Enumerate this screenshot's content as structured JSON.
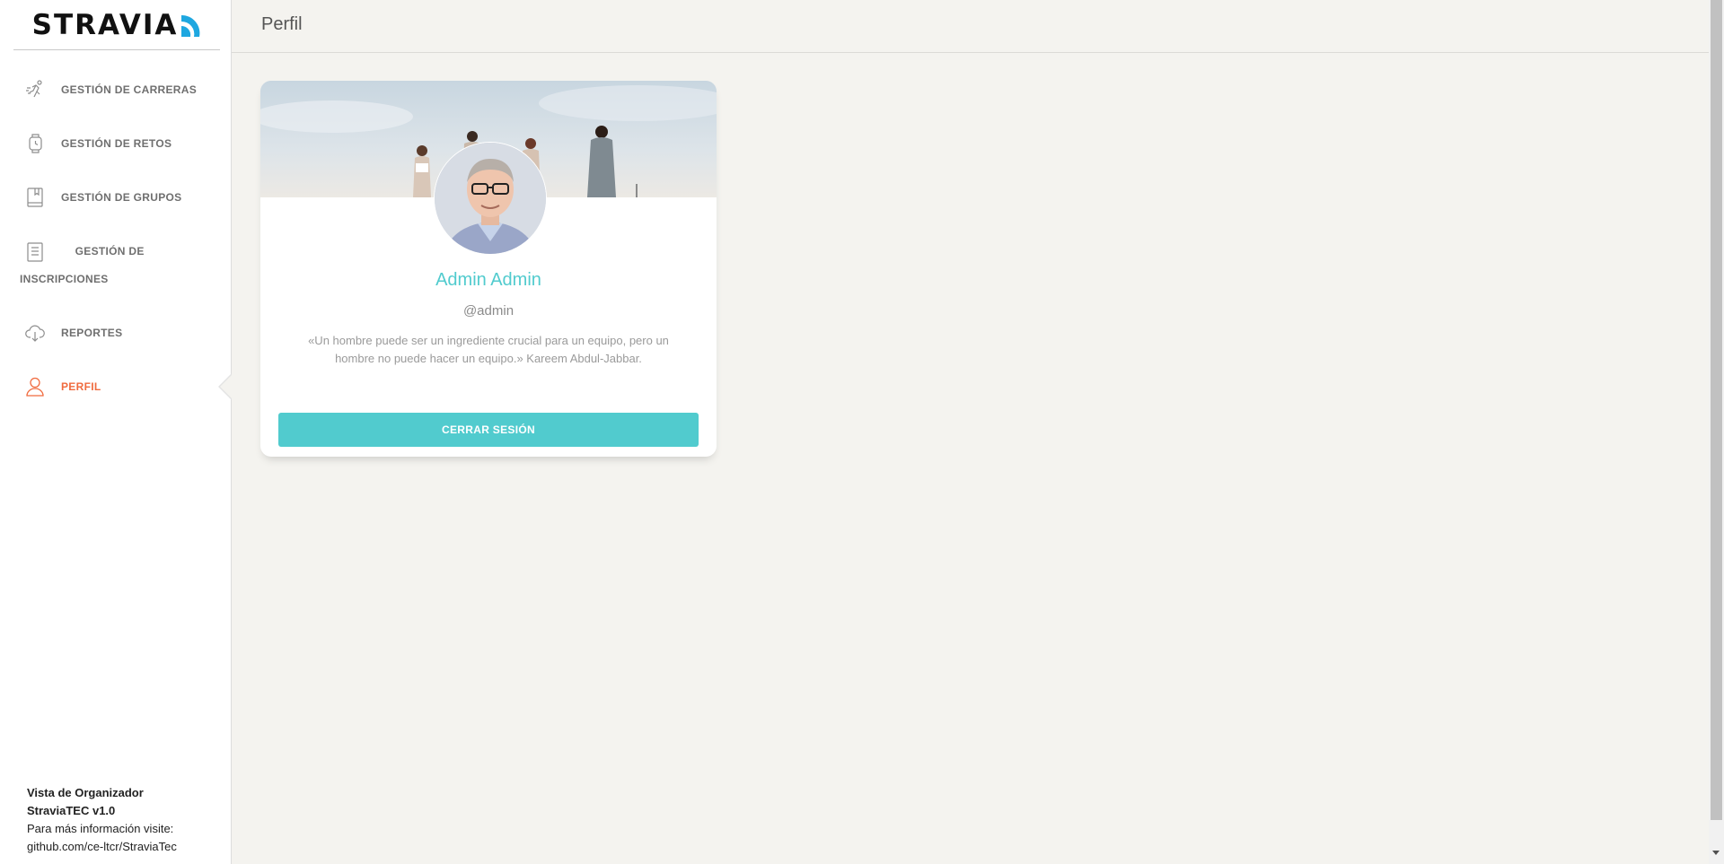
{
  "brand": {
    "name": "STRAVIA"
  },
  "sidebar": {
    "items": [
      {
        "label": "GESTIÓN DE CARRERAS",
        "icon": "runner-icon",
        "active": false
      },
      {
        "label": "GESTIÓN DE RETOS",
        "icon": "watch-icon",
        "active": false
      },
      {
        "label": "GESTIÓN DE GRUPOS",
        "icon": "bookmark-book-icon",
        "active": false
      },
      {
        "label": "GESTIÓN DE INSCRIPCIONES",
        "icon": "paper-list-icon",
        "active": false
      },
      {
        "label": "REPORTES",
        "icon": "cloud-download-icon",
        "active": false
      },
      {
        "label": "PERFIL",
        "icon": "user-icon",
        "active": true
      }
    ],
    "footer": {
      "line1": "Vista de Organizador",
      "line2": "StraviaTEC v1.0",
      "line3": "Para más información visite:",
      "line4": "github.com/ce-ltcr/StraviaTec"
    }
  },
  "header": {
    "title": "Perfil"
  },
  "profile": {
    "name": "Admin Admin",
    "username": "@admin",
    "quote": "«Un hombre puede ser un ingrediente crucial para un equipo, pero un hombre no puede hacer un equipo.» Kareem Abdul-Jabbar.",
    "logout_label": "CERRAR SESIÓN"
  },
  "colors": {
    "accent": "#51cbce",
    "active_nav": "#f06b3f",
    "background": "#f4f3ef",
    "logo_mark": "#1ea7e0"
  }
}
